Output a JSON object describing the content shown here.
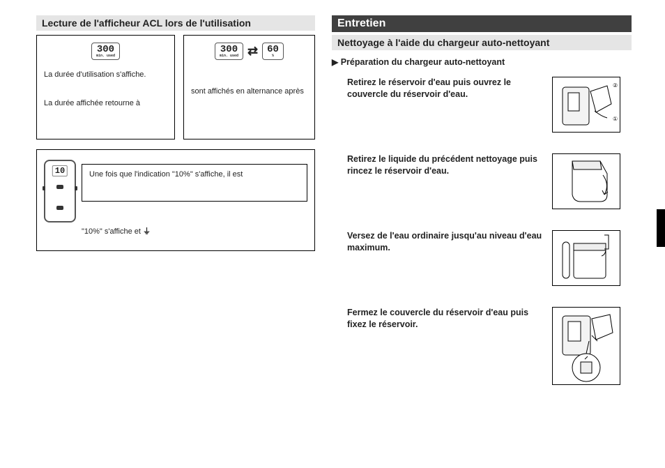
{
  "left": {
    "heading": "Lecture de l'afficheur ACL lors de l'utilisation",
    "box_a": {
      "lcd_value": "300",
      "lcd_unit": "min. used",
      "line1": "La durée d'utilisation s'affiche.",
      "line2": "La durée affichée retourne à"
    },
    "box_b": {
      "lcd_left_value": "300",
      "lcd_left_unit": "min. used",
      "lcd_right_value": "60",
      "lcd_right_unit": "%",
      "line1": "sont affichés en alternance après"
    },
    "box_c": {
      "shaver_lcd": "10",
      "callout": "Une fois que l'indication \"10%\" s'affiche, il est",
      "under": "\"10%\" s'affiche et"
    }
  },
  "right": {
    "heading_dark": "Entretien",
    "heading_sub": "Nettoyage à l'aide du chargeur auto-nettoyant",
    "prep_heading": "Préparation du chargeur auto-nettoyant",
    "steps": [
      {
        "text": "Retirez le réservoir d'eau puis ouvrez le couvercle du réservoir d'eau."
      },
      {
        "text": "Retirez le liquide du précédent nettoyage puis rincez le réservoir d'eau."
      },
      {
        "text": "Versez de l'eau ordinaire jusqu'au niveau d'eau maximum."
      },
      {
        "text": "Fermez le couvercle du réservoir d'eau puis fixez le réservoir."
      }
    ]
  }
}
